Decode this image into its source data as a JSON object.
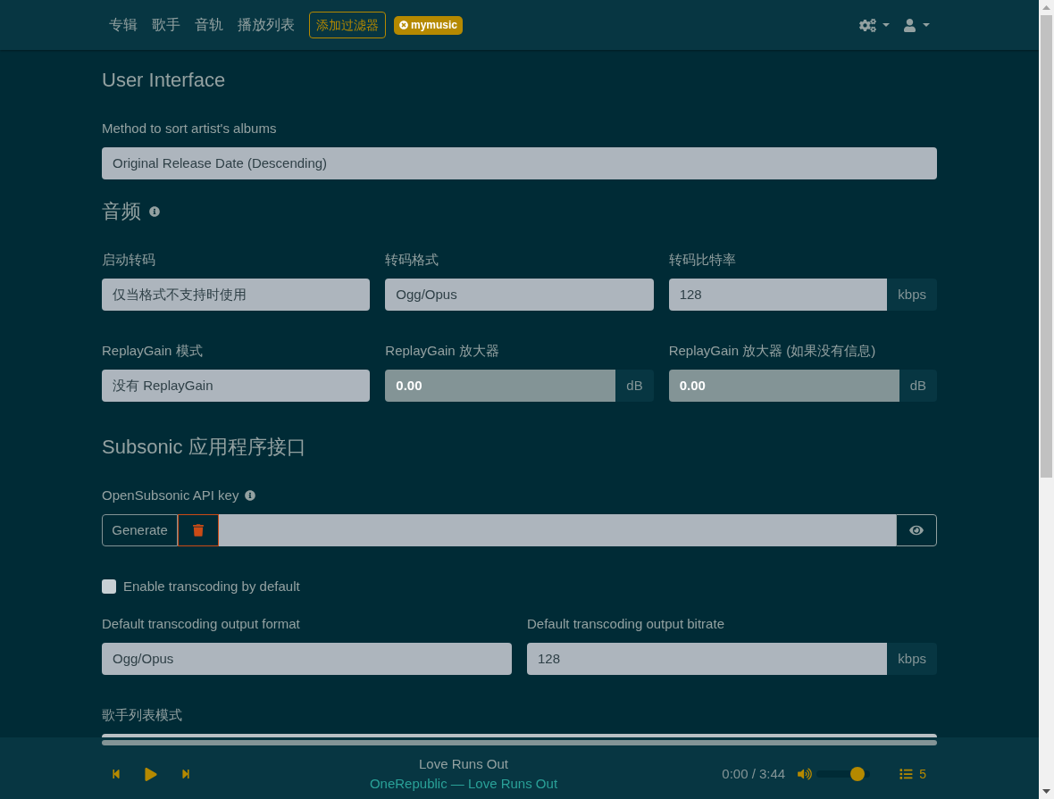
{
  "nav": {
    "links": [
      {
        "label": "专辑"
      },
      {
        "label": "歌手"
      },
      {
        "label": "音轨"
      },
      {
        "label": "播放列表"
      }
    ],
    "filter_button": "添加过滤器",
    "filter_tag": "mymusic"
  },
  "sections": [
    {
      "title": "User Interface",
      "info": false,
      "rows": [
        [
          {
            "kind": "select",
            "label": "Method to sort artist's albums",
            "value": "Original Release Date (Descending)",
            "disabled": false
          }
        ]
      ]
    },
    {
      "title": "音频",
      "info": true,
      "rows": [
        [
          {
            "kind": "select",
            "label": "启动转码",
            "value": "仅当格式不支持时使用",
            "disabled": false
          },
          {
            "kind": "select",
            "label": "转码格式",
            "value": "Ogg/Opus",
            "disabled": false
          },
          {
            "kind": "input",
            "label": "转码比特率",
            "value": "128",
            "unit": "kbps",
            "disabled": false
          }
        ],
        [
          {
            "kind": "select",
            "label": "ReplayGain 模式",
            "value": "没有 ReplayGain",
            "disabled": false
          },
          {
            "kind": "input",
            "label": "ReplayGain 放大器",
            "value": "0.00",
            "unit": "dB",
            "disabled": true
          },
          {
            "kind": "input",
            "label": "ReplayGain 放大器 (如果没有信息)",
            "value": "0.00",
            "unit": "dB",
            "disabled": true
          }
        ]
      ]
    },
    {
      "title": "Subsonic 应用程序接口",
      "info": false,
      "rows": [
        [
          {
            "kind": "api_key",
            "label": "OpenSubsonic API key",
            "info": true,
            "button": "Generate"
          }
        ],
        [
          {
            "kind": "checkbox",
            "label": "Enable transcoding by default",
            "checked": false
          }
        ],
        [
          {
            "kind": "select",
            "label": "Default transcoding output format",
            "value": "Ogg/Opus",
            "disabled": false
          },
          {
            "kind": "input",
            "label": "Default transcoding output bitrate",
            "value": "128",
            "unit": "kbps",
            "disabled": false
          }
        ],
        [
          {
            "kind": "partial",
            "label": "歌手列表模式"
          }
        ]
      ]
    }
  ],
  "player": {
    "title": "Love Runs Out",
    "subtitle": "OneRepublic — Love Runs Out",
    "time": "0:00 / 3:44",
    "volume": {
      "level": 0.85
    },
    "queue_count": "5"
  }
}
